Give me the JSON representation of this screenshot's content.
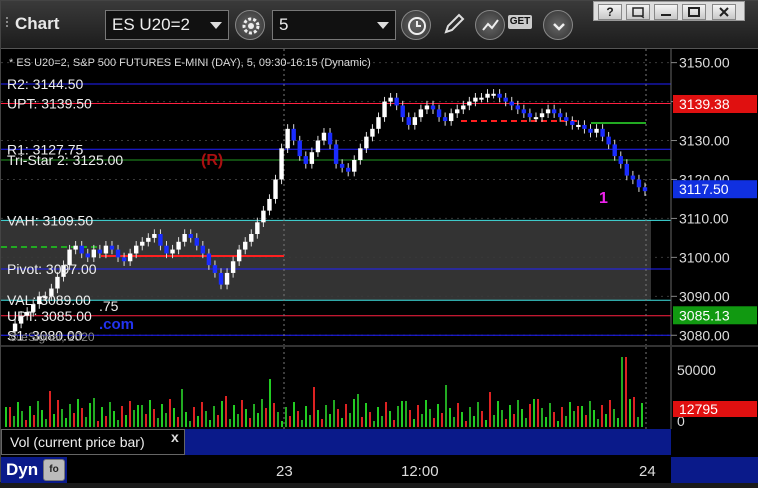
{
  "toolbar": {
    "app_title": "Chart",
    "symbol": "ES U20=2",
    "interval": "5",
    "get_label": "GET"
  },
  "window_controls": {
    "help": "?",
    "restore": "",
    "minimize": "",
    "maximize": "",
    "close": ""
  },
  "chart": {
    "header": "* ES U20=2, S&P 500 FUTURES E-MINI (DAY), 5, 09:30-16:15 (Dynamic)",
    "watermark": "© eSignal, 2020",
    "levels": [
      {
        "label": "R2: 3144.50",
        "price": 3144.5,
        "color": "#2020ff"
      },
      {
        "label": "UPT: 3139.50",
        "price": 3139.5,
        "color": "#ff2040"
      },
      {
        "label": "R1: 3127.75",
        "price": 3127.75,
        "color": "#2020ff"
      },
      {
        "label": "Tri-Star 2: 3125.00",
        "price": 3125.0,
        "color": "#229922"
      },
      {
        "label": "VAH: 3109.50",
        "price": 3109.5,
        "color": "#40e0e0"
      },
      {
        "label": "Pivot: 3097.00",
        "price": 3097.0,
        "color": "#2020ff"
      },
      {
        "label": "VAL: 3089.00",
        "price": 3089.0,
        "color": "#40e0e0"
      },
      {
        "label": "UPT: 3085.00",
        "price": 3085.0,
        "color": "#ff2040"
      },
      {
        "label": "S1: 3080.00",
        "price": 3080.0,
        "color": "#2020ff"
      }
    ],
    "extra_texts": [
      ".75",
      ".com"
    ],
    "r_marker": "(R)",
    "count_label": "1",
    "yaxis": {
      "ticks": [
        "3150.00",
        "3140.00",
        "3130.00",
        "3120.00",
        "3110.00",
        "3100.00",
        "3090.00",
        "3080.00"
      ],
      "tick_values": [
        3150,
        3140,
        3130,
        3120,
        3110,
        3100,
        3090,
        3080
      ],
      "min": 3077.5,
      "max": 3153.5
    },
    "price_tags": [
      {
        "label": "3139.38",
        "value": 3139.38,
        "color": "#e01010"
      },
      {
        "label": "3117.50",
        "value": 3117.5,
        "color": "#1030e0"
      },
      {
        "label": "3085.13",
        "value": 3085.13,
        "color": "#119911"
      }
    ],
    "xaxis": {
      "ticks": [
        "23",
        "12:00",
        "24"
      ]
    }
  },
  "volume": {
    "label": "Vol (current price bar)",
    "close_symbol": "x",
    "ticks": [
      "50000",
      "0"
    ],
    "tag": "12795",
    "tag_color": "#e01010"
  },
  "bottom": {
    "dyn_label": "Dyn",
    "lock_icon": "lock-icon"
  }
}
